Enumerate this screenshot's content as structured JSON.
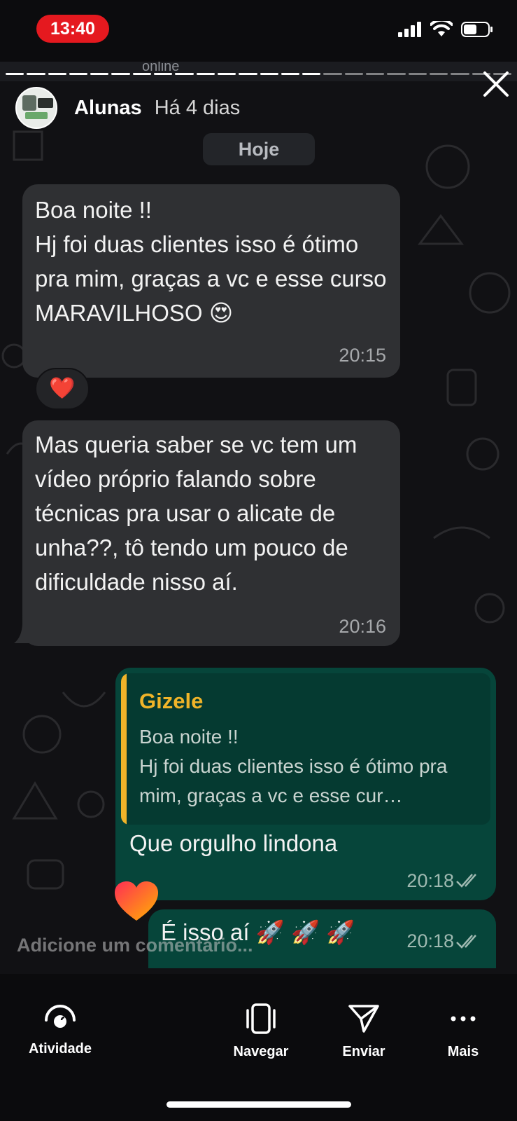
{
  "status_bar": {
    "time": "13:40"
  },
  "peek": {
    "status": "online"
  },
  "story": {
    "title": "Alunas",
    "age": "Há 4 dias",
    "segments_total": 24,
    "segments_done": 15
  },
  "chat": {
    "date_label": "Hoje",
    "messages": [
      {
        "direction": "incoming",
        "text": "Boa noite !!\nHj foi duas clientes isso é ótimo pra mim, graças a vc e esse curso MARAVILHOSO 😍",
        "time": "20:15",
        "reaction": "❤️"
      },
      {
        "direction": "incoming",
        "text": "Mas queria saber se vc tem um vídeo próprio falando sobre técnicas pra usar o alicate de unha??, tô tendo um pouco de dificuldade nisso aí.",
        "time": "20:16"
      },
      {
        "direction": "outgoing",
        "quote_author": "Gizele",
        "quote_text": "Boa noite !!\nHj foi duas clientes isso é ótimo pra mim, graças a vc e esse cur…",
        "text": "Que orgulho lindona",
        "time": "20:18"
      },
      {
        "direction": "outgoing",
        "text": "É isso aí 🚀 🚀 🚀",
        "time": "20:18"
      }
    ]
  },
  "comment_placeholder": "Adicione um comentário...",
  "bottom_nav": [
    {
      "icon": "activity-icon",
      "label": "Atividade"
    },
    {
      "icon": "navigate-icon",
      "label": "Navegar"
    },
    {
      "icon": "send-icon",
      "label": "Enviar"
    },
    {
      "icon": "more-icon",
      "label": "Mais"
    }
  ],
  "colors": {
    "incoming_bubble": "#2f3033",
    "outgoing_bubble": "#06453a",
    "quote_accent": "#f0b429",
    "time_pill": "#e5191f"
  }
}
